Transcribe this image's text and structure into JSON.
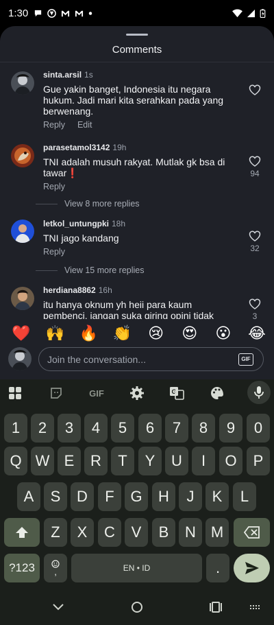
{
  "status_bar": {
    "time": "1:30",
    "left_icons": [
      "chat-bubble-icon",
      "vpn-icon",
      "gmail-icon",
      "gmail-icon",
      "dot-icon"
    ],
    "right_icons": [
      "wifi-icon",
      "signal-icon",
      "battery-icon"
    ]
  },
  "sheet": {
    "title": "Comments"
  },
  "comments": [
    {
      "user": "sinta.arsil",
      "time": "1s",
      "text": "Gue yakin banget, Indonesia itu negara hukum. Jadi mari kita serahkan pada yang berwenang.",
      "actions": [
        "Reply",
        "Edit"
      ],
      "likes": ""
    },
    {
      "user": "parasetamol3142",
      "time": "19h",
      "text": "TNI adalah musuh rakyat. Mutlak gk bsa di tawar❗",
      "actions": [
        "Reply"
      ],
      "likes": "94",
      "more_replies": "View 8 more replies"
    },
    {
      "user": "letkol_untungpki",
      "time": "18h",
      "text": "TNI jago kandang",
      "actions": [
        "Reply"
      ],
      "likes": "32",
      "more_replies": "View 15 more replies"
    },
    {
      "user": "herdiana8862",
      "time": "16h",
      "text": "itu hanya oknum yh heii para kaum pembenci, jangan suka giring opini tidak",
      "actions": [],
      "likes": "3"
    }
  ],
  "emoji_bar": [
    "❤️",
    "🙌",
    "🔥",
    "👏",
    "😢",
    "😍",
    "😮",
    "😂"
  ],
  "compose": {
    "placeholder": "Join the conversation...",
    "gif_label": "GIF"
  },
  "keyboard": {
    "toolbar": {
      "gif_label": "GIF"
    },
    "rows": [
      [
        "1",
        "2",
        "3",
        "4",
        "5",
        "6",
        "7",
        "8",
        "9",
        "0"
      ],
      [
        "Q",
        "W",
        "E",
        "R",
        "T",
        "Y",
        "U",
        "I",
        "O",
        "P"
      ],
      [
        "A",
        "S",
        "D",
        "F",
        "G",
        "H",
        "J",
        "K",
        "L"
      ],
      [
        "Z",
        "X",
        "C",
        "V",
        "B",
        "N",
        "M"
      ]
    ],
    "symbols_label": "?123",
    "emoji_key_label": ",",
    "space_label": "EN • ID",
    "period_label": "."
  }
}
